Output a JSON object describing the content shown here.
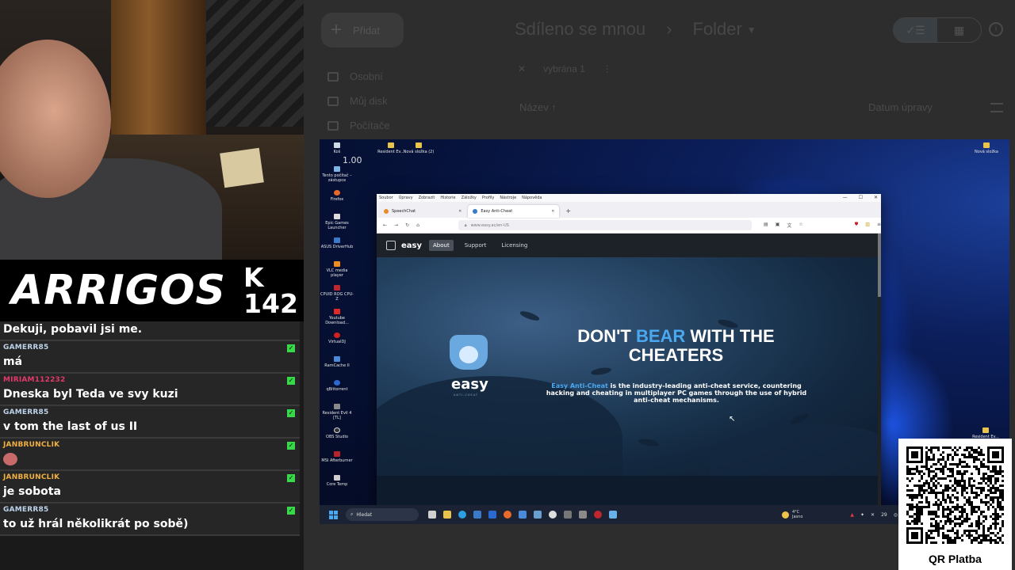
{
  "overlay": {
    "channel_name": "ARRIGOS",
    "channel_count": "K 142",
    "qr_label": "QR Platba"
  },
  "chat": {
    "messages": [
      {
        "user": "",
        "text": "Dekuji, pobavil jsi me.",
        "user_color": "#bcd2ea"
      },
      {
        "user": "GAMERR85",
        "text": "má",
        "user_color": "#bcd2ea"
      },
      {
        "user": "MIRIAM112232",
        "text": "Dneska byl Teda ve svy kuzi",
        "user_color": "#e03a6a"
      },
      {
        "user": "GAMERR85",
        "text": "v tom the last of us II",
        "user_color": "#bcd2ea"
      },
      {
        "user": "JANBRUNCLIK",
        "text": "",
        "user_color": "#f0b040",
        "emote": "emote-icon"
      },
      {
        "user": "JANBRUNCLIK",
        "text": "je sobota",
        "user_color": "#f0b040"
      },
      {
        "user": "GAMERR85",
        "text": "to už hrál několikrát po sobě)",
        "user_color": "#bcd2ea"
      }
    ],
    "badge_icon": "green-checkmark-icon"
  },
  "gdrive": {
    "add_label": "Přidat",
    "nav": [
      "Osobní",
      "Můj disk",
      "Počítače"
    ],
    "breadcrumb": [
      "Sdíleno se mnou",
      "Folder"
    ],
    "selected_text": "vybrána 1",
    "col_name": "Název",
    "col_date": "Datum úpravy"
  },
  "desktop": {
    "zoom": "1.00",
    "icons_left": [
      "Koš",
      "Tento počítač – zástupce",
      "Firefox",
      "Epic Games Launcher",
      "ASUS DriverHub",
      "VLC media player",
      "CPUID ROG CPU-Z",
      "Youtube Download...",
      "VirtualDJ",
      "RamCache II",
      "qBittorrent",
      "Resident Evil 4 [TL]",
      "OBS Studio",
      "MSI Afterburner",
      "Core Temp"
    ],
    "icons_top": [
      "Resident Ev...",
      "Nová složka (2)"
    ],
    "icon_top_right": "Nová složka",
    "icon_bottom_right": "Resident Ev..."
  },
  "firefox": {
    "menu": [
      "Soubor",
      "Úpravy",
      "Zobrazit",
      "Historie",
      "Záložky",
      "Profily",
      "Nástroje",
      "Nápověda"
    ],
    "tabs": [
      {
        "title": "SpeechChat",
        "active": false
      },
      {
        "title": "Easy Anti-Cheat",
        "active": true
      }
    ],
    "url": "www.easy.ac/en-US"
  },
  "site": {
    "logo": "easy",
    "nav": [
      "About",
      "Support",
      "Licensing"
    ],
    "brand_word": "easy",
    "brand_sub": "ANTI-CHEAT",
    "title_pre": "DON'T ",
    "title_accent": "BEAR",
    "title_post": " WITH THE CHEATERS",
    "desc_accent": "Easy Anti-Cheat",
    "desc_rest": " is the industry-leading anti-cheat service, countering hacking and cheating in multiplayer PC games through the use of hybrid anti-cheat mechanisms.",
    "accent_color": "#4aa8f0"
  },
  "taskbar": {
    "search_placeholder": "Hledat",
    "weather_temp": "4°C",
    "weather_desc": "Jasno",
    "tray_day": "29"
  }
}
